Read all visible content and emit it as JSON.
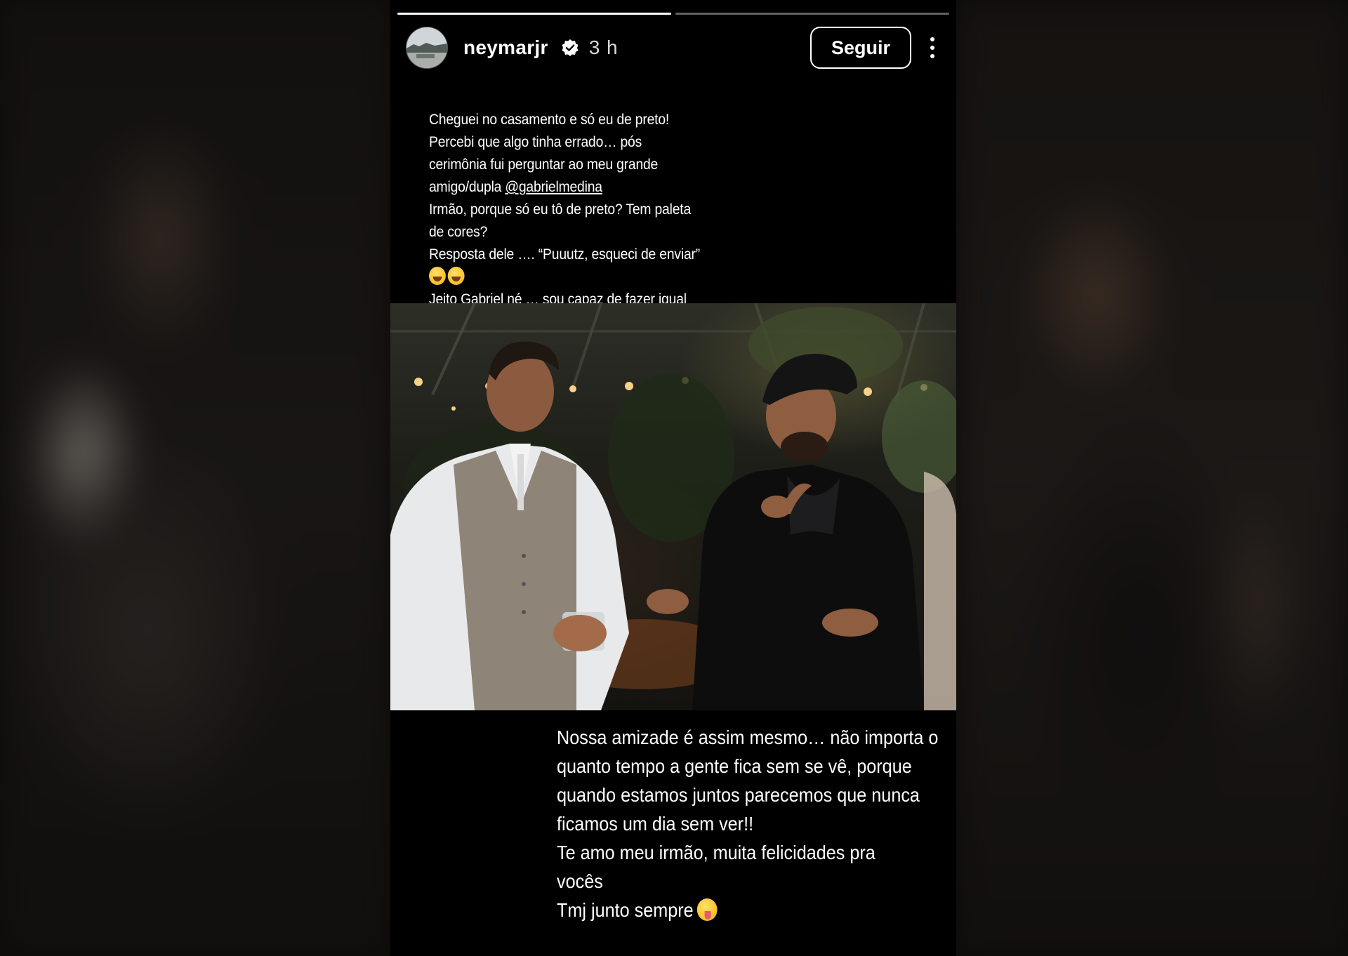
{
  "story": {
    "progress": [
      1.0,
      0.0
    ],
    "author": {
      "username": "neymarjr",
      "verified": true,
      "time": "3 h",
      "avatar_icon": "avatar-landscape-icon"
    },
    "follow_label": "Seguir",
    "more_icon": "more-vertical-icon",
    "caption_top": {
      "lines": [
        "Cheguei no casamento e só eu de preto!",
        "Percebi que algo tinha errado… pós",
        "cerimônia fui perguntar ao meu grande"
      ],
      "mention_prefix": "amigo/dupla ",
      "mention": "@gabrielmedina",
      "lines2": [
        "Irmão, porque só eu tô de preto? Tem paleta",
        "de cores?",
        "Resposta dele …. “Puuutz, esqueci de enviar”"
      ],
      "emojis": [
        "laughing-tears-emoji",
        "grinning-sweat-emoji"
      ],
      "last_line": "Jeito Gabriel né … sou capaz de fazer igual"
    },
    "photo_icon": "wedding-photo",
    "caption_bottom": {
      "lines": [
        "Nossa amizade é assim mesmo… não importa o",
        "quanto tempo a gente fica sem se vê, porque",
        "quando estamos juntos parecemos que nunca",
        "ficamos um dia sem ver!!",
        "Te amo meu irmão, muita felicidades pra",
        "vocês"
      ],
      "last_line": "Tmj junto sempre",
      "emoji": "zany-face-emoji"
    }
  }
}
